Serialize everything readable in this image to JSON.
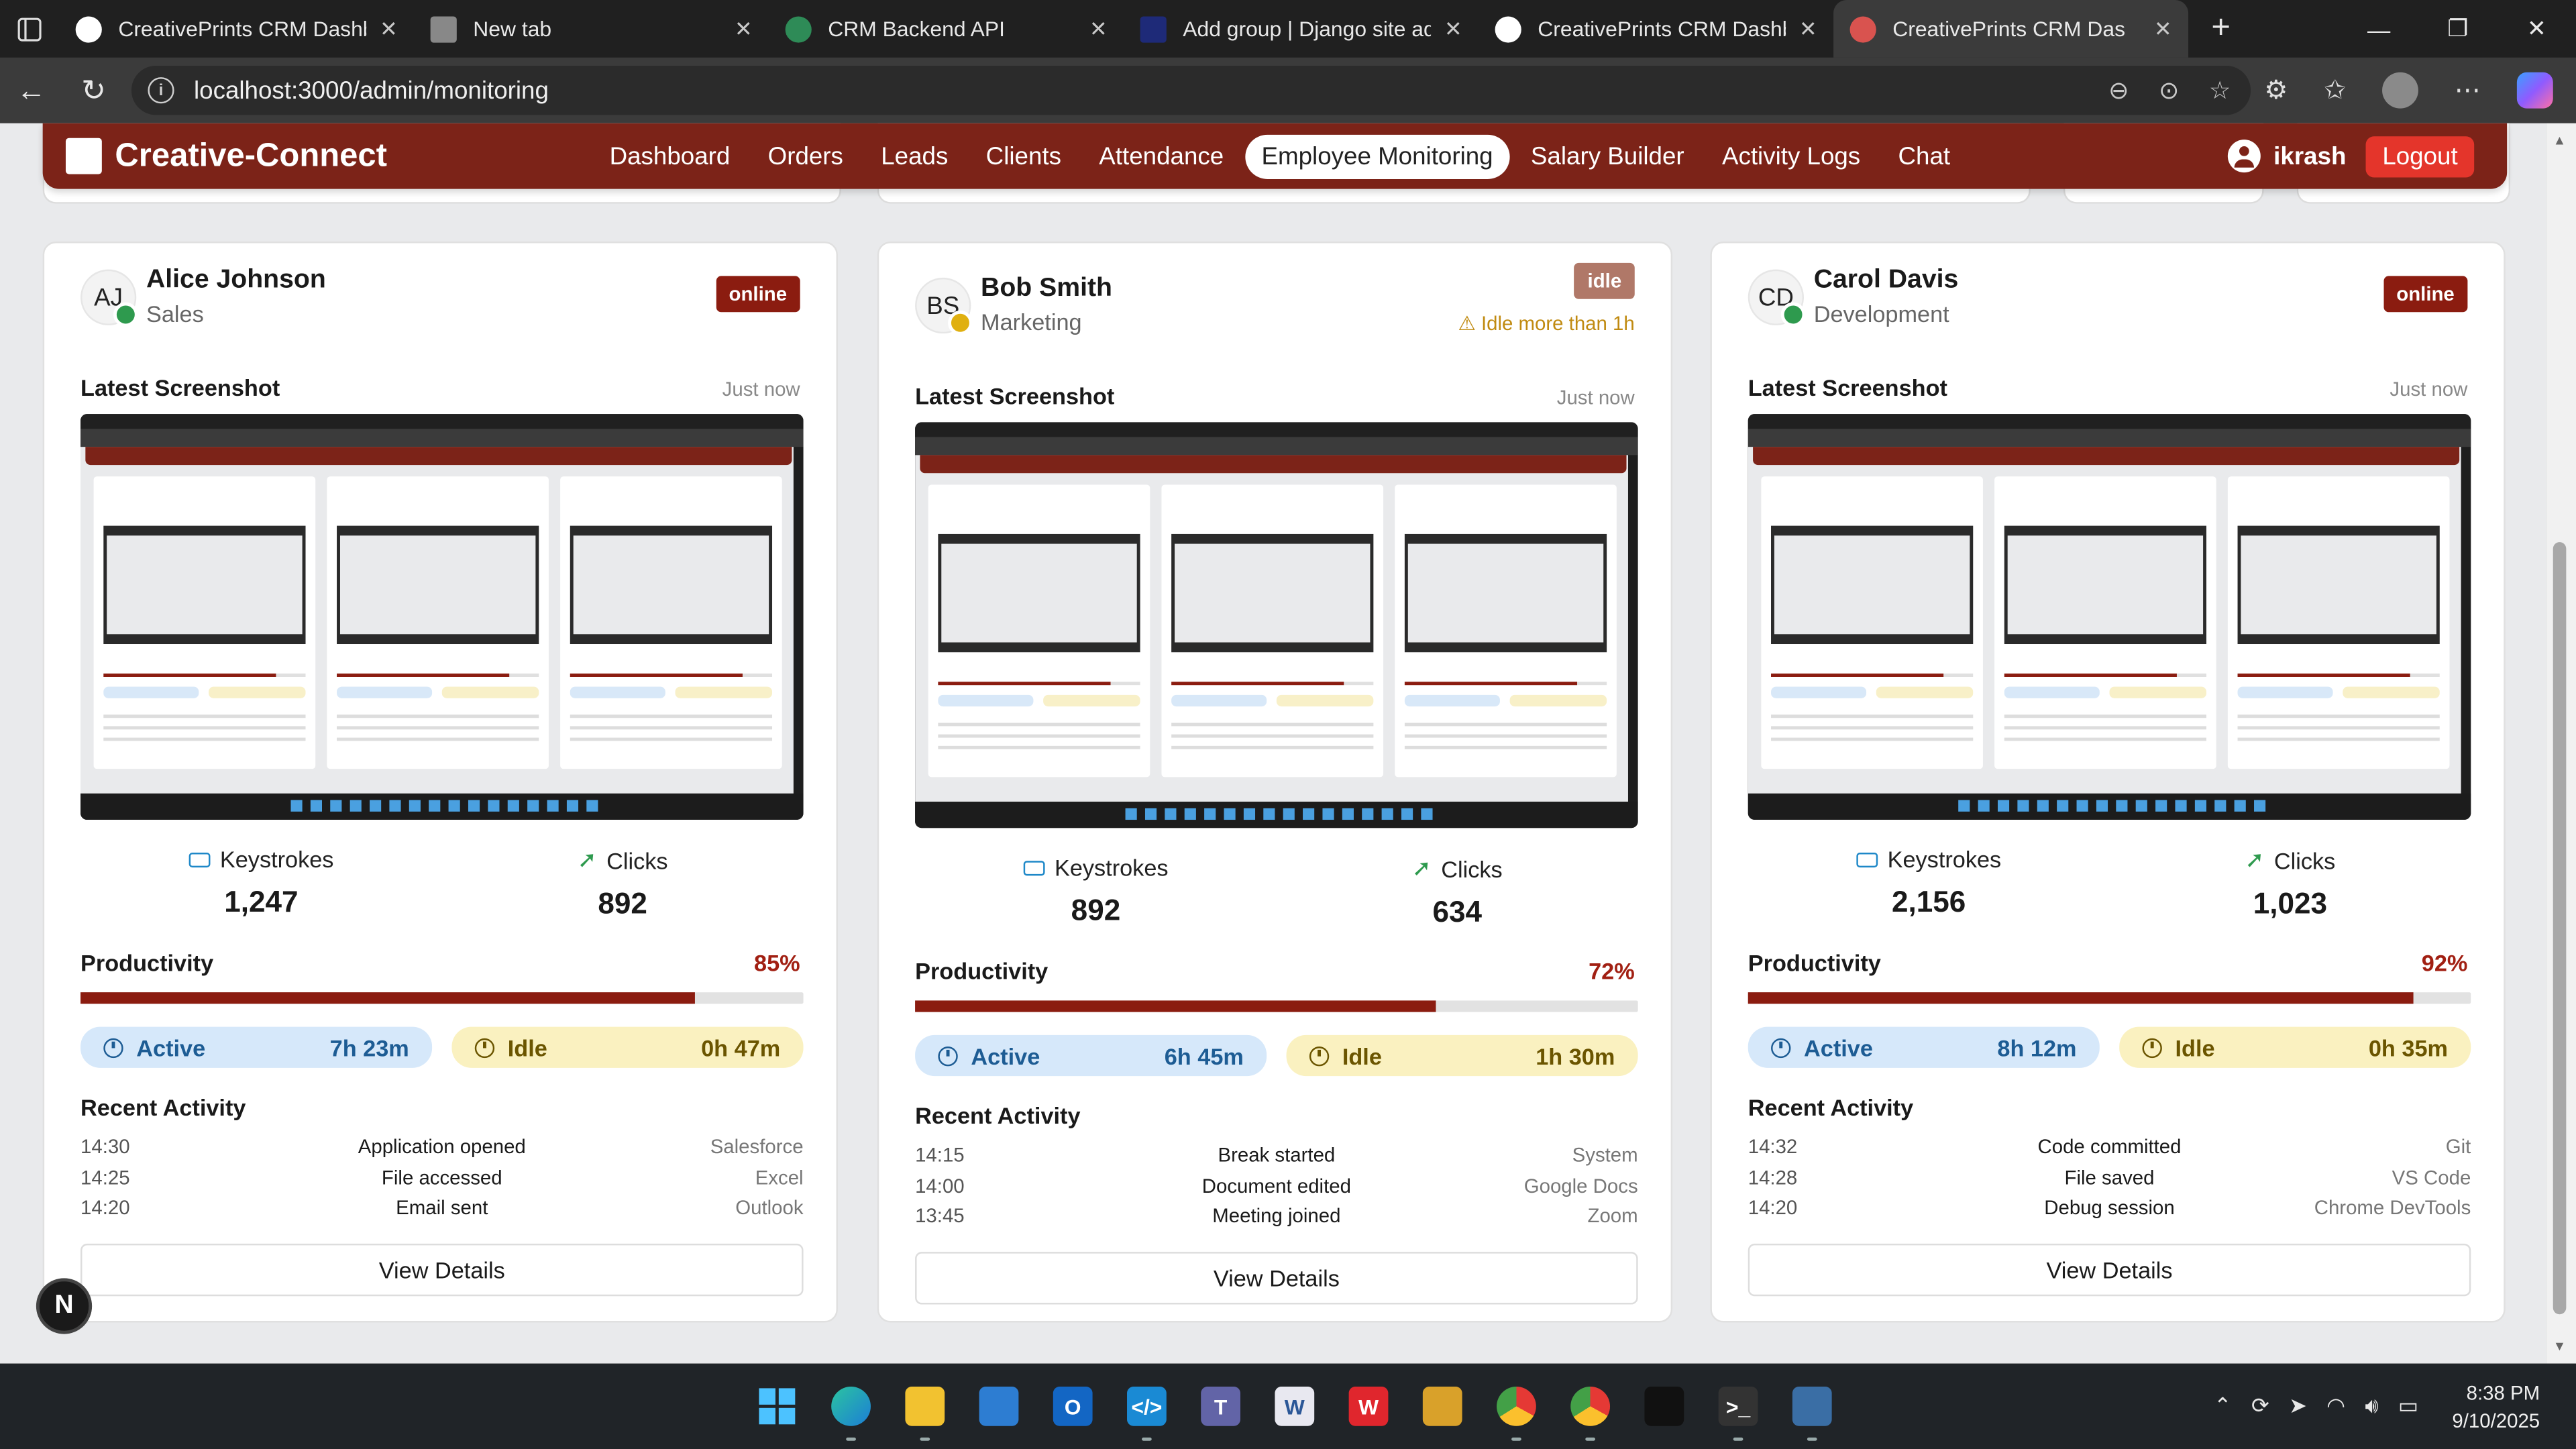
{
  "browser": {
    "tabs": [
      {
        "title": "CreativePrints CRM Dashboa",
        "active": false,
        "favicon_color": "#ffffff"
      },
      {
        "title": "New tab",
        "active": false,
        "favicon_color": "#cccccc"
      },
      {
        "title": "CRM Backend API",
        "active": false,
        "favicon_color": "#2e8b57"
      },
      {
        "title": "Add group | Django site adm",
        "active": false,
        "favicon_color": "#1e2a78"
      },
      {
        "title": "CreativePrints CRM Dashboa",
        "active": false,
        "favicon_color": "#ffffff"
      },
      {
        "title": "CreativePrints CRM Das",
        "active": true,
        "favicon_color": "#d9534f"
      }
    ],
    "url": "localhost:3000/admin/monitoring"
  },
  "app": {
    "brand": "Creative-Connect",
    "nav": [
      "Dashboard",
      "Orders",
      "Leads",
      "Clients",
      "Attendance",
      "Employee Monitoring",
      "Salary Builder",
      "Activity Logs",
      "Chat"
    ],
    "active_nav": "Employee Monitoring",
    "user": "ikrash",
    "logout_label": "Logout"
  },
  "labels": {
    "latest_screenshot": "Latest Screenshot",
    "keystrokes": "Keystrokes",
    "clicks": "Clicks",
    "productivity": "Productivity",
    "active": "Active",
    "idle": "Idle",
    "recent_activity": "Recent Activity",
    "view_details": "View Details"
  },
  "employees": [
    {
      "initials": "AJ",
      "name": "Alice Johnson",
      "department": "Sales",
      "status": "online",
      "status_color": "#2e9a4e",
      "idle_warning": "",
      "screenshot_time": "Just now",
      "keystrokes": "1,247",
      "clicks": "892",
      "productivity_label": "85%",
      "productivity": 0.85,
      "active_time": "7h 23m",
      "idle_time": "0h 47m",
      "activity": [
        {
          "time": "14:30",
          "action": "Application opened",
          "source": "Salesforce"
        },
        {
          "time": "14:25",
          "action": "File accessed",
          "source": "Excel"
        },
        {
          "time": "14:20",
          "action": "Email sent",
          "source": "Outlook"
        }
      ]
    },
    {
      "initials": "BS",
      "name": "Bob Smith",
      "department": "Marketing",
      "status": "idle",
      "status_color": "#e0b010",
      "idle_warning": "Idle more than 1h",
      "screenshot_time": "Just now",
      "keystrokes": "892",
      "clicks": "634",
      "productivity_label": "72%",
      "productivity": 0.72,
      "active_time": "6h 45m",
      "idle_time": "1h 30m",
      "activity": [
        {
          "time": "14:15",
          "action": "Break started",
          "source": "System"
        },
        {
          "time": "14:00",
          "action": "Document edited",
          "source": "Google Docs"
        },
        {
          "time": "13:45",
          "action": "Meeting joined",
          "source": "Zoom"
        }
      ]
    },
    {
      "initials": "CD",
      "name": "Carol Davis",
      "department": "Development",
      "status": "online",
      "status_color": "#2e9a4e",
      "idle_warning": "",
      "screenshot_time": "Just now",
      "keystrokes": "2,156",
      "clicks": "1,023",
      "productivity_label": "92%",
      "productivity": 0.92,
      "active_time": "8h 12m",
      "idle_time": "0h 35m",
      "activity": [
        {
          "time": "14:32",
          "action": "Code committed",
          "source": "Git"
        },
        {
          "time": "14:28",
          "action": "File saved",
          "source": "VS Code"
        },
        {
          "time": "14:20",
          "action": "Debug session",
          "source": "Chrome DevTools"
        }
      ]
    }
  ],
  "floating_badge": "N",
  "taskbar": {
    "apps": [
      "start",
      "edge",
      "file-explorer",
      "store",
      "outlook",
      "vscode",
      "teams",
      "word",
      "wps",
      "explorer-2",
      "chrome",
      "chrome-profile",
      "epic",
      "terminal",
      "snipping"
    ],
    "time": "8:38 PM",
    "date": "9/10/2025"
  }
}
